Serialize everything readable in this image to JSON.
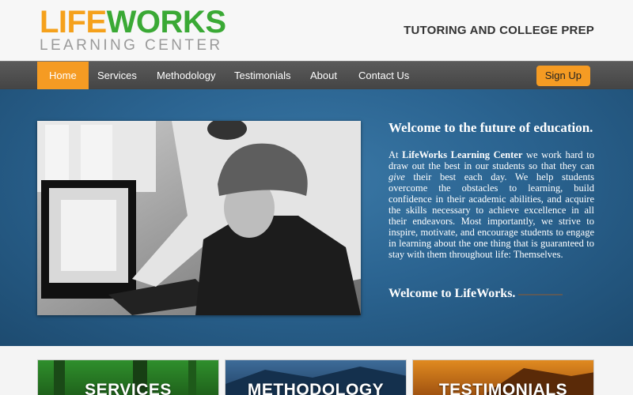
{
  "header": {
    "logo_life": "LIFE",
    "logo_works": "WORKS",
    "logo_sub": "LEARNING CENTER",
    "tagline": "TUTORING AND COLLEGE PREP"
  },
  "nav": {
    "items": [
      {
        "label": "Home",
        "active": true
      },
      {
        "label": "Services"
      },
      {
        "label": "Methodology"
      },
      {
        "label": "Testimonials"
      },
      {
        "label": "About"
      },
      {
        "label": "Contact Us"
      }
    ],
    "signup": "Sign Up"
  },
  "hero": {
    "title": "Welcome to the future of education.",
    "para_prefix": "At ",
    "para_bold": "LifeWorks Learning Center",
    "para_mid": " we work hard to draw out the best in our students so that they can ",
    "para_italic": "give",
    "para_rest": " their best each day. We help students overcome the obstacles to learning, build confidence in their academic abilities, and acquire the skills necessary to achieve excellence in all their endeavors. Most importantly, we strive to inspire, motivate, and encourage students to engage in learning about the one thing that is guaranteed to stay with them throughout life: Themselves.",
    "bottom": "Welcome to LifeWorks."
  },
  "cards": [
    {
      "label": "SERVICES"
    },
    {
      "label": "METHODOLOGY"
    },
    {
      "label": "TESTIMONIALS"
    }
  ],
  "colors": {
    "accent_orange": "#f59b23",
    "logo_green": "#3aa935",
    "hero_blue": "#2b6491"
  }
}
